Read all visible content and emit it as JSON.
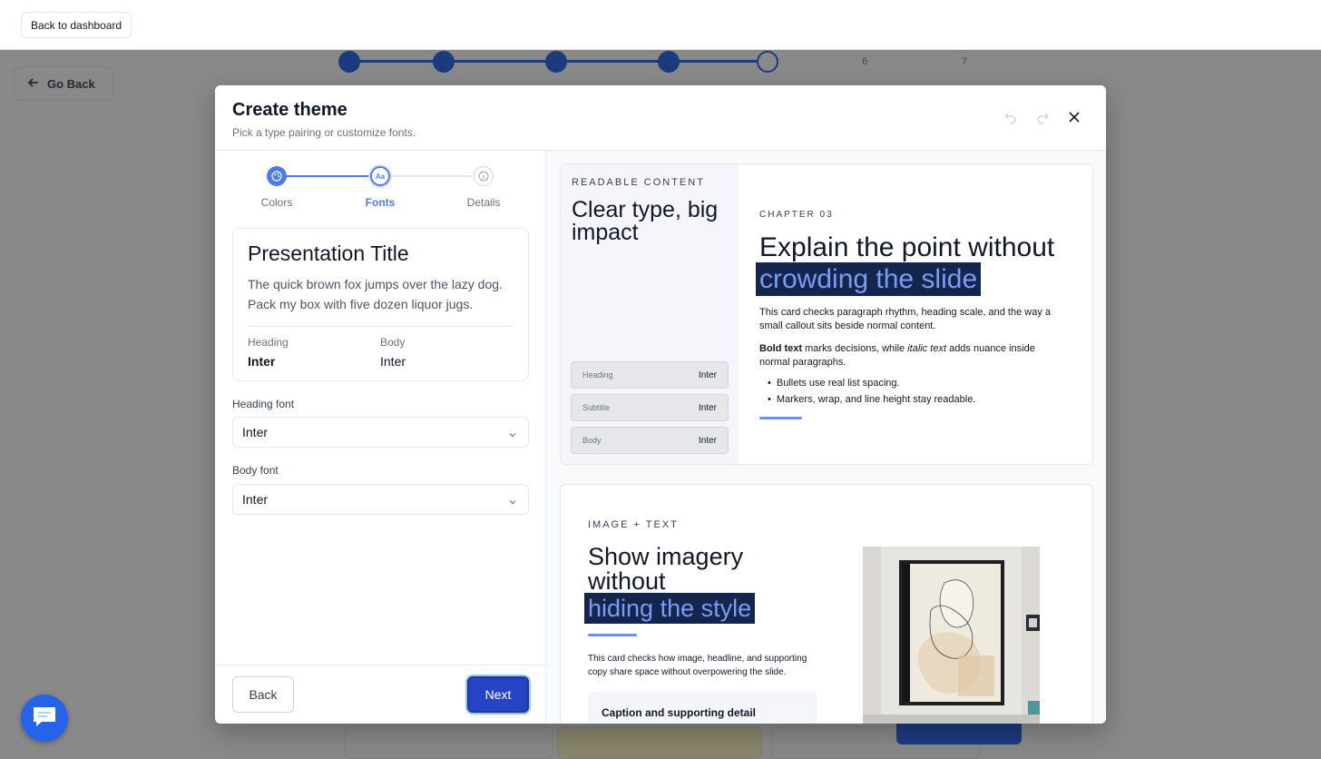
{
  "topbar": {
    "back_label": "Back to dashboard"
  },
  "background": {
    "go_back_label": "Go Back",
    "step_numbers": [
      "6",
      "7"
    ]
  },
  "modal": {
    "title": "Create theme",
    "subtitle": "Pick a type pairing or customize fonts.",
    "steps": [
      {
        "label": "Colors",
        "state": "done"
      },
      {
        "label": "Fonts",
        "state": "active"
      },
      {
        "label": "Details",
        "state": "todo"
      }
    ],
    "preview": {
      "title": "Presentation Title",
      "body": "The quick brown fox jumps over the lazy dog. Pack my box with five dozen liquor jugs.",
      "heading_caption": "Heading",
      "heading_value": "Inter",
      "body_caption": "Body",
      "body_value": "Inter"
    },
    "heading_font": {
      "label": "Heading font",
      "value": "Inter"
    },
    "body_font": {
      "label": "Body font",
      "value": "Inter"
    },
    "footer": {
      "back_label": "Back",
      "next_label": "Next"
    }
  },
  "slide1": {
    "kicker": "READABLE CONTENT",
    "big_title": "Clear type, big impact",
    "chips": [
      {
        "key": "Heading",
        "value": "Inter"
      },
      {
        "key": "Subtitle",
        "value": "Inter"
      },
      {
        "key": "Body",
        "value": "Inter"
      }
    ],
    "chapter": "CHAPTER 03",
    "headline_plain": "Explain the point without",
    "headline_highlight": "crowding the slide",
    "para1": "This card checks paragraph rhythm, heading scale, and the way a small callout sits beside normal content.",
    "para2_bold": "Bold text",
    "para2_mid": " marks decisions, while ",
    "para2_italic": "italic text",
    "para2_end": " adds nuance inside normal paragraphs.",
    "bullets": [
      "Bullets use real list spacing.",
      "Markers, wrap, and line height stay readable."
    ]
  },
  "slide2": {
    "kicker": "IMAGE + TEXT",
    "headline_plain": "Show imagery without",
    "headline_highlight": "hiding the style",
    "para": "This card checks how image, headline, and supporting copy share space without overpowering the slide.",
    "caption": "Caption and supporting detail"
  },
  "colors": {
    "primary": "#2563eb",
    "next_button": "#2744c7",
    "highlight_bg": "#14254e",
    "highlight_text": "#7b9cf0"
  }
}
